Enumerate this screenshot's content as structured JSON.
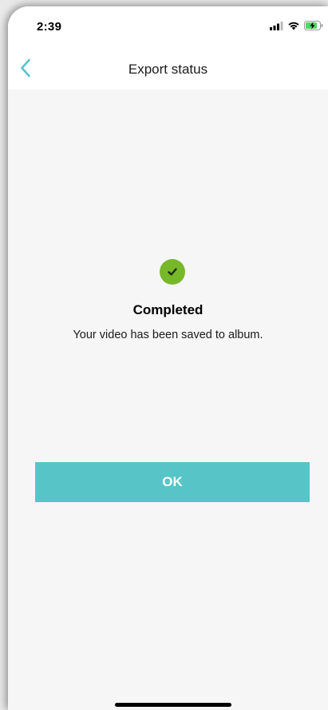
{
  "status_bar": {
    "time": "2:39",
    "icons": [
      "signal-icon",
      "wifi-icon",
      "battery-charging-icon"
    ]
  },
  "nav": {
    "title": "Export status",
    "back_icon": "chevron-left-icon"
  },
  "result": {
    "icon": "check-circle-icon",
    "title": "Completed",
    "message": "Your video has been saved to album."
  },
  "actions": {
    "ok_label": "OK"
  },
  "colors": {
    "accent": "#57c4c8",
    "success": "#76b82a",
    "background": "#f6f6f6",
    "bar_background": "#ffffff"
  }
}
